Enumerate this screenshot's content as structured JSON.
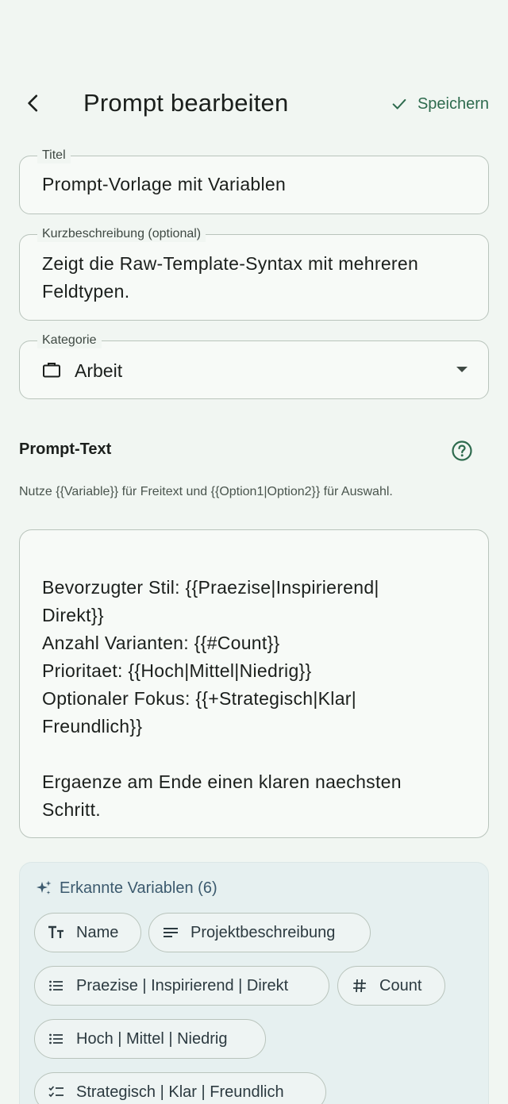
{
  "header": {
    "title": "Prompt bearbeiten",
    "save_label": "Speichern"
  },
  "form": {
    "title": {
      "label": "Titel",
      "value": "Prompt-Vorlage mit Variablen"
    },
    "description": {
      "label": "Kurzbeschreibung (optional)",
      "value": "Zeigt die Raw-Template-Syntax mit mehreren Feldtypen."
    },
    "category": {
      "label": "Kategorie",
      "value": "Arbeit",
      "icon": "briefcase-icon"
    }
  },
  "prompt": {
    "section_title": "Prompt-Text",
    "hint": "Nutze {{Variable}} für Freitext und {{Option1|Option2}} für Auswahl.",
    "text": "Bevorzugter Stil: {{Praezise|Inspirierend|\nDirekt}}\nAnzahl Varianten: {{#Count}}\nPrioritaet: {{Hoch|Mittel|Niedrig}}\nOptionaler Fokus: {{+Strategisch|Klar|\nFreundlich}}\n\nErgaenze am Ende einen klaren naechsten\nSchritt."
  },
  "variables": {
    "header": "Erkannte Variablen (6)",
    "chips": [
      {
        "label": "Name",
        "icon": "text-type-icon"
      },
      {
        "label": "Projektbeschreibung",
        "icon": "paragraph-icon"
      },
      {
        "label": "Praezise | Inspirierend | Direkt",
        "icon": "list-icon"
      },
      {
        "label": "Count",
        "icon": "number-icon"
      },
      {
        "label": "Hoch | Mittel | Niedrig",
        "icon": "list-icon"
      },
      {
        "label": "Strategisch | Klar | Freundlich",
        "icon": "checklist-icon"
      }
    ]
  },
  "colors": {
    "background": "#f1f6f2",
    "accent": "#2e6b4e",
    "panel": "#e6f0f0"
  }
}
